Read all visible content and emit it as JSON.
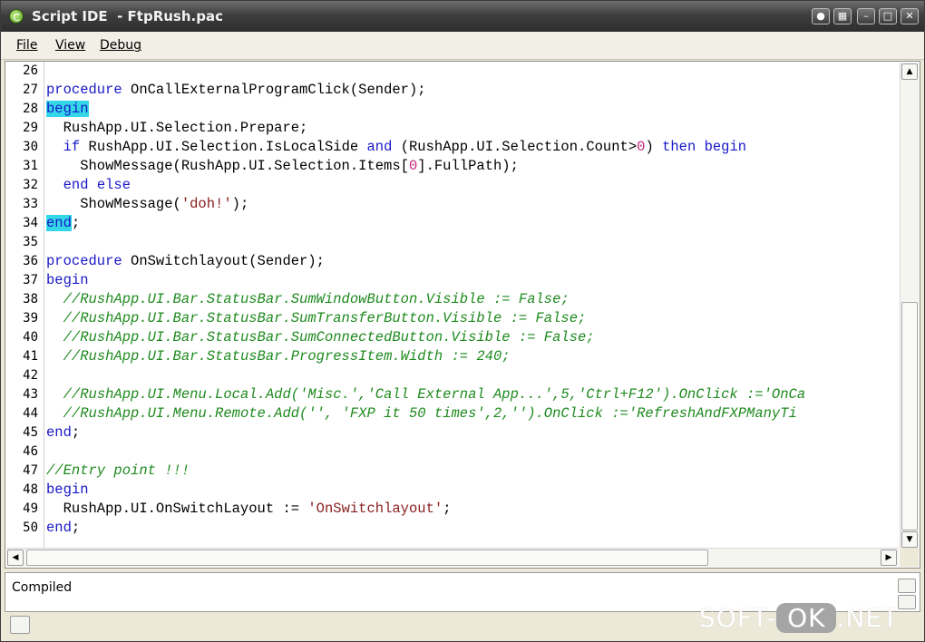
{
  "window": {
    "title": "Script IDE  - FtpRush.pac",
    "title_buttons": [
      "pin",
      "restore-layout",
      "minimize",
      "maximize",
      "close"
    ]
  },
  "menu": {
    "items": [
      {
        "label": "File"
      },
      {
        "label": "View"
      },
      {
        "label": "Debug"
      }
    ]
  },
  "editor": {
    "colors": {
      "keyword": "#1818c8",
      "comment": "#1e8a1e",
      "string": "#8a2020",
      "number": "#c2257a",
      "highlight": "#33d7e8"
    },
    "lines": [
      {
        "num": "26",
        "tokens": []
      },
      {
        "num": "27",
        "tokens": [
          [
            "kw",
            "procedure"
          ],
          [
            "t",
            " OnCallExternalProgramClick(Sender);"
          ]
        ]
      },
      {
        "num": "28",
        "tokens": [
          [
            "kwhl",
            "begin"
          ]
        ]
      },
      {
        "num": "29",
        "tokens": [
          [
            "t",
            "  RushApp.UI.Selection.Prepare;"
          ]
        ]
      },
      {
        "num": "30",
        "tokens": [
          [
            "t",
            "  "
          ],
          [
            "kw",
            "if"
          ],
          [
            "t",
            " RushApp.UI.Selection.IsLocalSide "
          ],
          [
            "kw",
            "and"
          ],
          [
            "t",
            " (RushApp.UI.Selection.Count>"
          ],
          [
            "num",
            "0"
          ],
          [
            "t",
            ") "
          ],
          [
            "kw",
            "then begin"
          ]
        ]
      },
      {
        "num": "31",
        "tokens": [
          [
            "t",
            "    ShowMessage(RushApp.UI.Selection.Items["
          ],
          [
            "num",
            "0"
          ],
          [
            "t",
            "].FullPath);"
          ]
        ]
      },
      {
        "num": "32",
        "tokens": [
          [
            "t",
            "  "
          ],
          [
            "kw",
            "end else"
          ]
        ]
      },
      {
        "num": "33",
        "tokens": [
          [
            "t",
            "    ShowMessage("
          ],
          [
            "st",
            "'doh!'"
          ],
          [
            "t",
            ");"
          ]
        ]
      },
      {
        "num": "34",
        "tokens": [
          [
            "kwhl",
            "end"
          ],
          [
            "t",
            ";"
          ]
        ]
      },
      {
        "num": "35",
        "tokens": []
      },
      {
        "num": "36",
        "tokens": [
          [
            "kw",
            "procedure"
          ],
          [
            "t",
            " OnSwitchlayout(Sender);"
          ]
        ]
      },
      {
        "num": "37",
        "tokens": [
          [
            "kw",
            "begin"
          ]
        ]
      },
      {
        "num": "38",
        "tokens": [
          [
            "t",
            "  "
          ],
          [
            "cm",
            "//RushApp.UI.Bar.StatusBar.SumWindowButton.Visible := False;"
          ]
        ]
      },
      {
        "num": "39",
        "tokens": [
          [
            "t",
            "  "
          ],
          [
            "cm",
            "//RushApp.UI.Bar.StatusBar.SumTransferButton.Visible := False;"
          ]
        ]
      },
      {
        "num": "40",
        "tokens": [
          [
            "t",
            "  "
          ],
          [
            "cm",
            "//RushApp.UI.Bar.StatusBar.SumConnectedButton.Visible := False;"
          ]
        ]
      },
      {
        "num": "41",
        "tokens": [
          [
            "t",
            "  "
          ],
          [
            "cm",
            "//RushApp.UI.Bar.StatusBar.ProgressItem.Width := 240;"
          ]
        ]
      },
      {
        "num": "42",
        "tokens": []
      },
      {
        "num": "43",
        "tokens": [
          [
            "t",
            "  "
          ],
          [
            "cm",
            "//RushApp.UI.Menu.Local.Add('Misc.','Call External App...',5,'Ctrl+F12').OnClick :='OnCa"
          ]
        ]
      },
      {
        "num": "44",
        "tokens": [
          [
            "t",
            "  "
          ],
          [
            "cm",
            "//RushApp.UI.Menu.Remote.Add('', 'FXP it 50 times',2,'').OnClick :='RefreshAndFXPManyTi"
          ]
        ]
      },
      {
        "num": "45",
        "tokens": [
          [
            "kw",
            "end"
          ],
          [
            "t",
            ";"
          ]
        ]
      },
      {
        "num": "46",
        "tokens": []
      },
      {
        "num": "47",
        "tokens": [
          [
            "cm",
            "//Entry point !!!"
          ]
        ]
      },
      {
        "num": "48",
        "tokens": [
          [
            "kw",
            "begin"
          ]
        ]
      },
      {
        "num": "49",
        "tokens": [
          [
            "t",
            "  RushApp.UI.OnSwitchLayout := "
          ],
          [
            "st",
            "'OnSwitchlayout'"
          ],
          [
            "t",
            ";"
          ]
        ]
      },
      {
        "num": "50",
        "tokens": [
          [
            "kw",
            "end"
          ],
          [
            "t",
            ";"
          ]
        ]
      }
    ]
  },
  "output": {
    "text": "Compiled"
  },
  "watermark": {
    "left": "SOFT-",
    "ok": "OK",
    "right": ".NET"
  }
}
